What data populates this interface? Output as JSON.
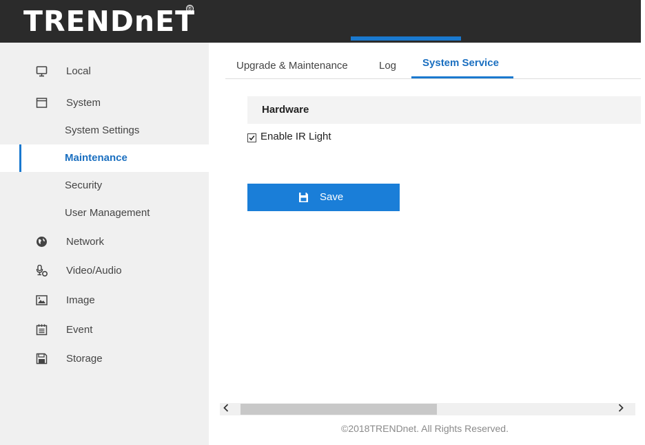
{
  "header": {
    "logo_text": "TRENDnET",
    "logo_mark": "®"
  },
  "sidebar": {
    "items": [
      {
        "label": "Local",
        "icon": "monitor-icon"
      },
      {
        "label": "System",
        "icon": "window-icon"
      },
      {
        "label": "System Settings",
        "sub": true
      },
      {
        "label": "Maintenance",
        "sub": true,
        "active": true
      },
      {
        "label": "Security",
        "sub": true
      },
      {
        "label": "User Management",
        "sub": true
      },
      {
        "label": "Network",
        "icon": "globe-icon"
      },
      {
        "label": "Video/Audio",
        "icon": "microphone-icon"
      },
      {
        "label": "Image",
        "icon": "image-icon"
      },
      {
        "label": "Event",
        "icon": "calendar-icon"
      },
      {
        "label": "Storage",
        "icon": "floppy-disk-icon"
      }
    ]
  },
  "tabs": [
    {
      "label": "Upgrade & Maintenance"
    },
    {
      "label": "Log"
    },
    {
      "label": "System Service",
      "active": true
    }
  ],
  "section": {
    "title": "Hardware",
    "ir_label": "Enable IR Light",
    "ir_checked": true
  },
  "save_button": {
    "label": "Save",
    "icon": "floppy-disk-icon"
  },
  "scrollbar": {
    "left_arrow": "‹",
    "right_arrow": "›"
  },
  "footer": {
    "text": "©2018TRENDnet. All Rights Reserved."
  },
  "colors": {
    "accent": "#1a79cf",
    "header_bg": "#2b2b2b",
    "sidebar_bg": "#f0f0f0"
  }
}
